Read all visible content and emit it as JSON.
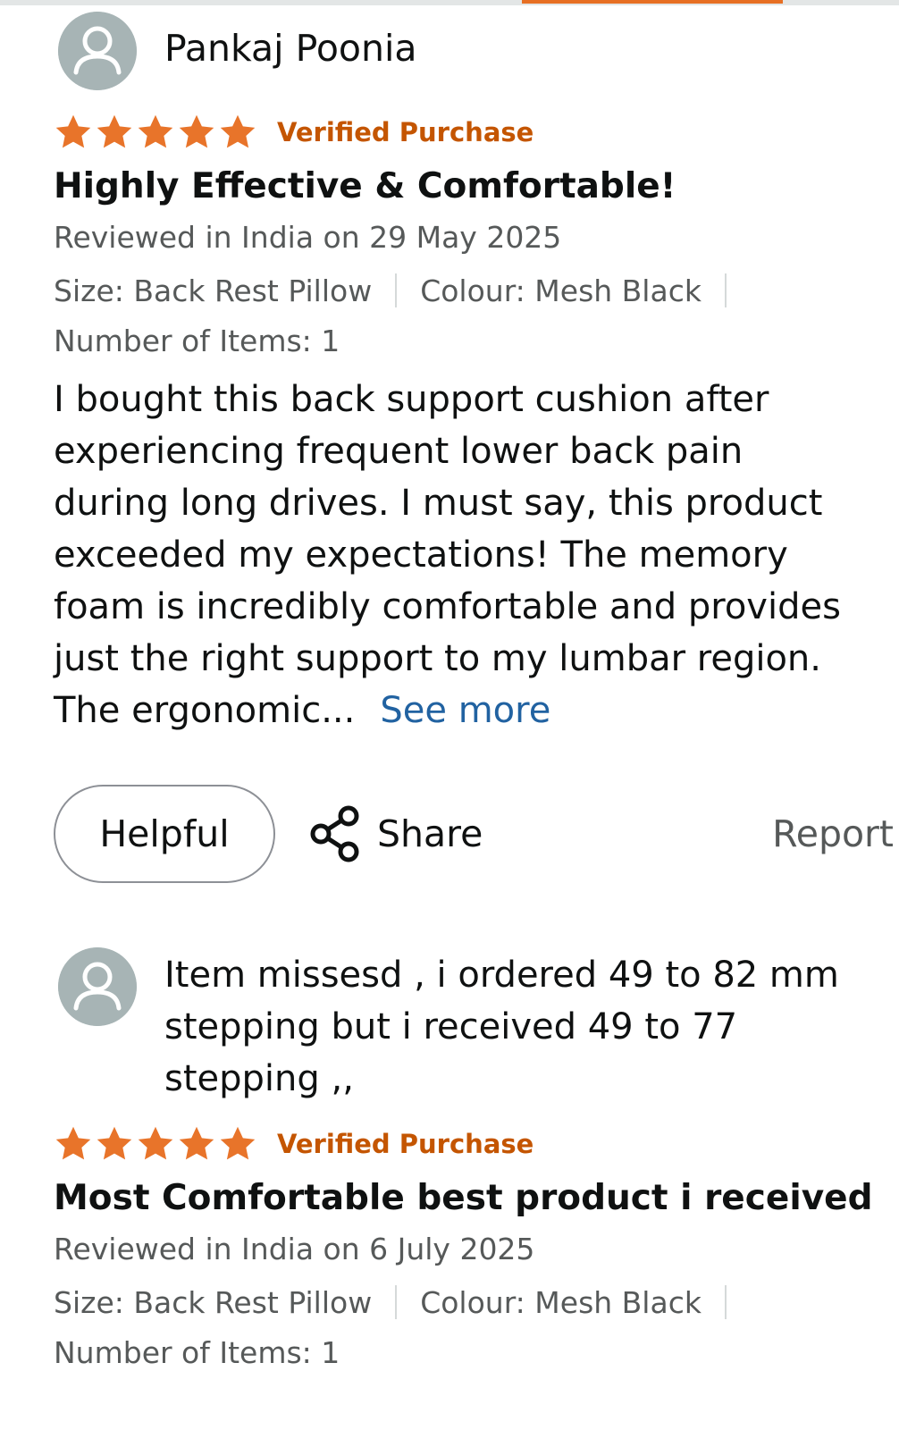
{
  "reviews": [
    {
      "reviewer": "Pankaj Poonia",
      "rating": 5,
      "verified": "Verified Purchase",
      "title": "Highly Effective & Comfortable!",
      "date": "Reviewed in India on 29 May 2025",
      "size": "Size: Back Rest Pillow",
      "colour": "Colour: Mesh Black",
      "items": "Number of Items: 1",
      "body": "I bought this back support cushion after experiencing frequent lower back pain during long drives. I must say, this product exceeded my expectations! The memory foam is incredibly comfortable and provides just the right support to my lumbar region. The ergonomic...",
      "see_more": "See more",
      "helpful": "Helpful",
      "share": "Share",
      "report": "Report"
    },
    {
      "reviewer": "Item missesd , i ordered 49 to 82 mm stepping but i received 49 to 77 stepping ,,",
      "rating": 5,
      "verified": "Verified Purchase",
      "title": "Most Comfortable best product i received",
      "date": "Reviewed in India on 6 July 2025",
      "size": "Size: Back Rest Pillow",
      "colour": "Colour: Mesh Black",
      "items": "Number of Items: 1"
    }
  ],
  "colors": {
    "star": "#e8742a",
    "verified": "#c45500",
    "link": "#2162a1",
    "secondary_text": "#565959",
    "accent_bar": "#e76f24"
  },
  "icons": [
    "user-avatar-icon",
    "star-icon",
    "share-icon"
  ]
}
